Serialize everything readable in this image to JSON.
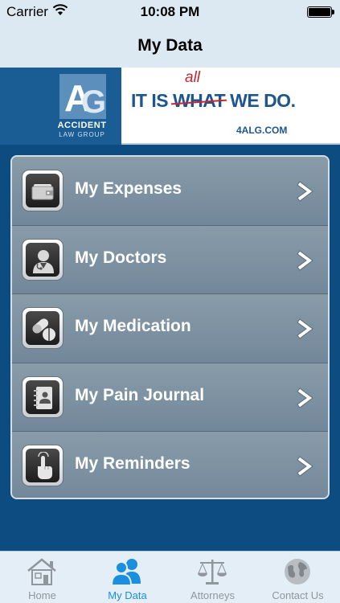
{
  "status_bar": {
    "carrier": "Carrier",
    "time": "10:08 PM"
  },
  "nav": {
    "title": "My Data"
  },
  "banner": {
    "logo_text": "ACCIDENT",
    "logo_subtext": "LAW GROUP",
    "slogan_start": "IT IS ",
    "slogan_struck": "WHAT",
    "slogan_end": " WE DO.",
    "slogan_insert": "all",
    "url": "4ALG.COM"
  },
  "menu": {
    "items": [
      {
        "label": "My Expenses",
        "icon": "wallet-icon"
      },
      {
        "label": "My Doctors",
        "icon": "doctor-icon"
      },
      {
        "label": "My Medication",
        "icon": "pills-icon"
      },
      {
        "label": "My Pain Journal",
        "icon": "journal-icon"
      },
      {
        "label": "My Reminders",
        "icon": "hand-tap-icon"
      }
    ]
  },
  "tabs": [
    {
      "label": "Home",
      "icon": "house-icon",
      "active": false
    },
    {
      "label": "My Data",
      "icon": "people-icon",
      "active": true
    },
    {
      "label": "Attorneys",
      "icon": "scales-icon",
      "active": false
    },
    {
      "label": "Contact Us",
      "icon": "globe-icon",
      "active": false
    }
  ],
  "colors": {
    "accent": "#1a8fe0",
    "brand_blue": "#0d4c80",
    "brand_red": "#c8262e"
  }
}
